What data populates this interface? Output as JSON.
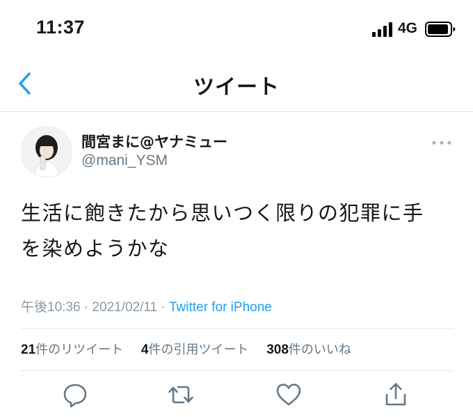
{
  "status_bar": {
    "time": "11:37",
    "network": "4G",
    "icons": [
      "signal-icon",
      "battery-icon"
    ]
  },
  "nav": {
    "title": "ツイート",
    "back_icon": "chevron-left-icon"
  },
  "tweet": {
    "author": {
      "display_name": "間宮まに@ヤナミュー",
      "handle": "@mani_YSM"
    },
    "text_line1": "生活に飽きたから思いつく限りの犯罪に手",
    "text_line2": "を染めようかな",
    "timestamp": "午後10:36 · 2021/02/11 · ",
    "source": "Twitter for iPhone"
  },
  "stats": {
    "retweets": {
      "count": "21",
      "label": "件のリツイート"
    },
    "quotes": {
      "count": "4",
      "label": "件の引用ツイート"
    },
    "likes": {
      "count": "308",
      "label": "件のいいね"
    }
  },
  "actions": [
    "reply-icon",
    "retweet-icon",
    "like-icon",
    "share-icon"
  ],
  "colors": {
    "accent": "#1da1f2",
    "muted_text": "#657786",
    "icon": "#657786",
    "divider": "#e1e4e6"
  }
}
